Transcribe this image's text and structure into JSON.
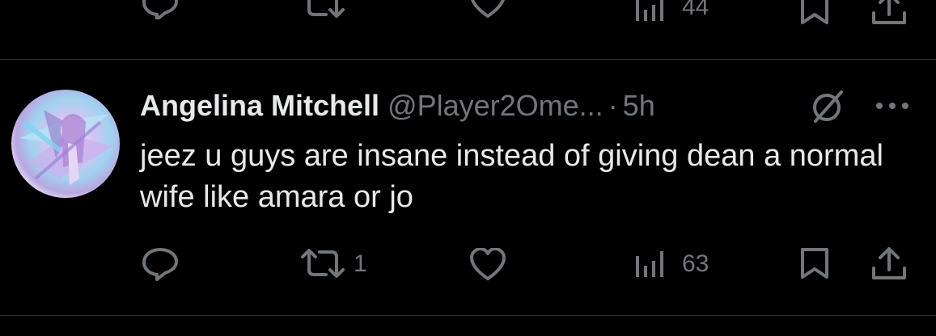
{
  "previous_tweet": {
    "views_count": "44"
  },
  "tweet": {
    "author_name": "Angelina Mitchell",
    "author_handle": "@Player2Ome...",
    "separator": "·",
    "timestamp": "5h",
    "text": "jeez u guys are insane instead of giving dean a normal wife like amara or jo",
    "actions": {
      "reply_count": "",
      "retweet_count": "1",
      "like_count": "",
      "views_count": "63"
    }
  },
  "icons": {
    "reply": "speech-bubble-outline",
    "retweet": "two-arrows-cycle",
    "like": "heart-outline",
    "views": "bar-chart",
    "bookmark": "bookmark-outline",
    "share": "upload-arrow",
    "more": "three-dots",
    "grok": "slashed-circle"
  },
  "colors": {
    "background": "#000000",
    "text_primary": "#e7e9ea",
    "text_secondary": "#71767b",
    "divider": "#2f3336"
  }
}
